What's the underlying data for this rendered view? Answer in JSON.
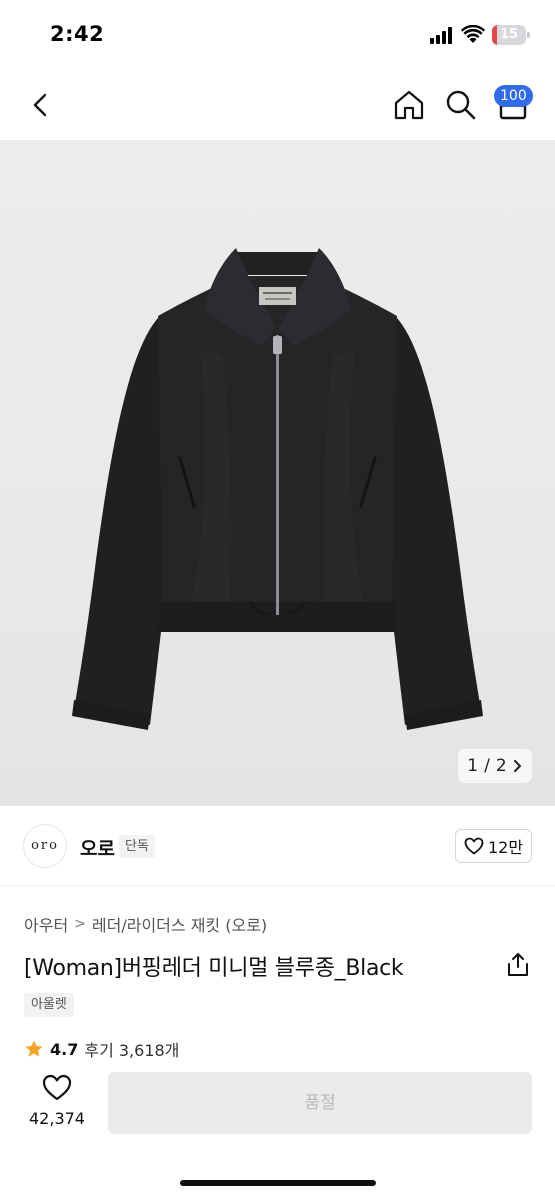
{
  "status_bar": {
    "time": "2:42",
    "battery_level": "15",
    "battery_fraction": 0.15,
    "battery_color": "#e5484d"
  },
  "nav": {
    "icons": [
      "chevron-left-icon",
      "home-icon",
      "search-icon",
      "shopping-bag-icon"
    ],
    "cart_count": "100",
    "badge_color": "#2f6bea"
  },
  "gallery": {
    "current": "1",
    "separator": "/",
    "total": "2",
    "next_icon": "chevron-right-icon"
  },
  "brand": {
    "logo_text": "oro",
    "name": "오로",
    "tag": "단독",
    "likes": "12만"
  },
  "product": {
    "breadcrumb": [
      "아우터",
      "레더/라이더스 재킷 (오로)"
    ],
    "breadcrumb_separator": ">",
    "title": "[Woman]버핑레더 미니멀 블루종_Black",
    "tag": "아울렛",
    "rating": "4.7",
    "reviews": "후기 3,618개"
  },
  "bottom_bar": {
    "wishlist_count": "42,374",
    "action_label": "품절"
  }
}
